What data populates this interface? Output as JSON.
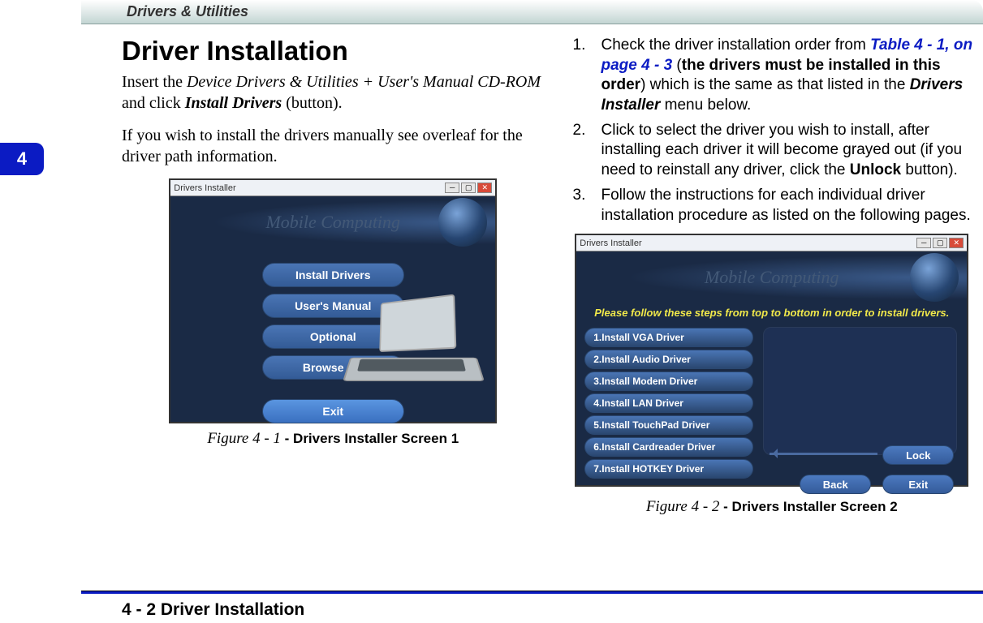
{
  "header": {
    "title": "Drivers & Utilities"
  },
  "chapter": "4",
  "left": {
    "heading": "Driver Installation",
    "p1_a": "Insert the ",
    "p1_ital": "Device Drivers & Utilities + User's Manual CD-ROM",
    "p1_b": " and click ",
    "p1_bold": "Install Drivers",
    "p1_c": " (button).",
    "p2": "If you wish to install the drivers manually see overleaf for the driver path information."
  },
  "fig1": {
    "window_title": "Drivers Installer",
    "banner": "Mobile Computing",
    "buttons": [
      "Install Drivers",
      "User's Manual",
      "Optional",
      "Browse CD"
    ],
    "exit": "Exit",
    "caption_it": "Figure 4 - 1 ",
    "caption_b": "- Drivers Installer Screen 1"
  },
  "right": {
    "li1_a": "Check the driver installation order from ",
    "li1_ref": "Table 4 - 1, on page 4 - 3",
    "li1_b": " (",
    "li1_bold1": "the drivers must be installed in this order",
    "li1_c": ") which is the same as that listed in the ",
    "li1_bold2": "Drivers Installer",
    "li1_d": " menu below.",
    "li2_a": "Click to select the driver you wish to install, after installing each driver it will become grayed out (if you need to reinstall any driver, click the ",
    "li2_bold": "Unlock",
    "li2_b": " button).",
    "li3": "Follow the instructions for each individual driver installation procedure as listed on the following pages."
  },
  "fig2": {
    "window_title": "Drivers Installer",
    "banner": "Mobile Computing",
    "prompt": "Please follow these steps from top to bottom in order to install drivers.",
    "drivers": [
      "1.Install VGA Driver",
      "2.Install Audio Driver",
      "3.Install Modem Driver",
      "4.Install LAN Driver",
      "5.Install TouchPad Driver",
      "6.Install Cardreader Driver",
      "7.Install HOTKEY Driver"
    ],
    "lock": "Lock",
    "back": "Back",
    "exit": "Exit",
    "caption_it": "Figure 4 - 2 ",
    "caption_b": "- Drivers Installer Screen 2"
  },
  "footer": {
    "page": "4 - 2",
    "section": "Driver Installation"
  }
}
